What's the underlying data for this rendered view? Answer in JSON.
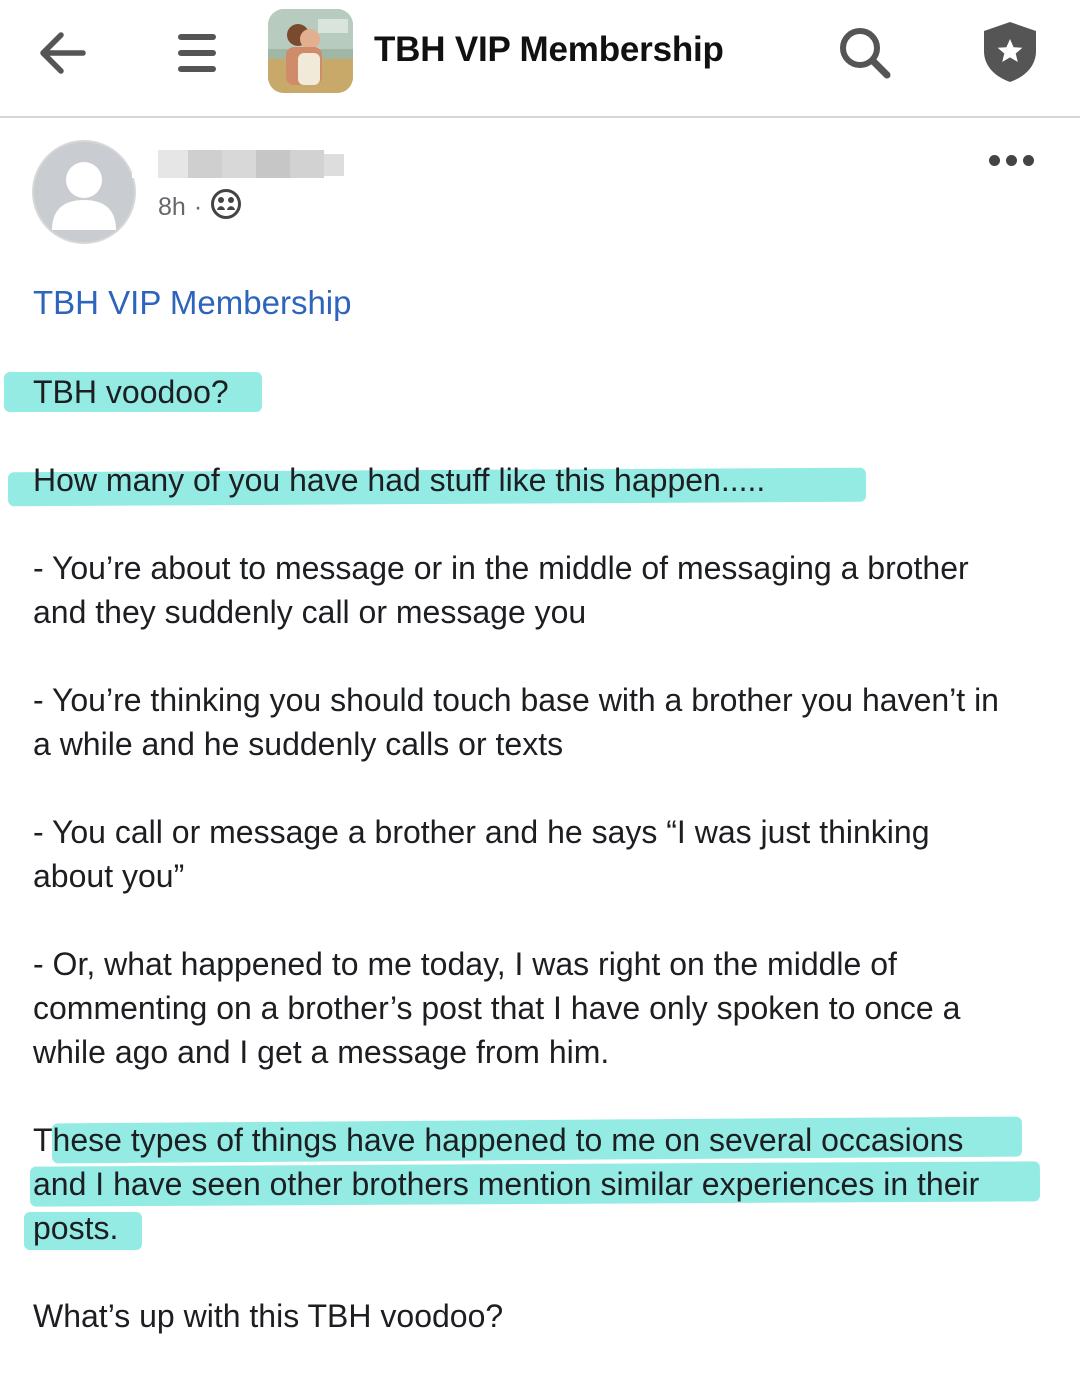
{
  "topbar": {
    "title": "TBH VIP Membership",
    "icons": [
      "back-arrow-icon",
      "menu-icon",
      "group-thumbnail",
      "search-icon",
      "shield-star-icon"
    ]
  },
  "post": {
    "time": "8h",
    "separator": "·",
    "audience_icon": "members-icon",
    "group_name": "TBH VIP Membership",
    "lines": {
      "title": "TBH voodoo?",
      "intro": "How many of you have had stuff like this happen.....",
      "item1_l1": "- You’re about to message or in the middle of messaging a brother",
      "item1_l2": "and they suddenly call or message you",
      "item2_l1": "- You’re thinking you should touch base with a brother you haven’t in",
      "item2_l2": "a while and he suddenly calls or texts",
      "item3_l1": "- You call or message a brother and he says “I was just thinking",
      "item3_l2": "about you”",
      "item4_l1": "- Or, what happened to me today, I was right on the middle of",
      "item4_l2": "commenting on a brother’s post that I have only spoken to once a",
      "item4_l3": "while ago and I get a message from him.",
      "para_l1": "These types of things have happened to me on several occasions",
      "para_l2": "and I have seen other brothers mention similar experiences in their",
      "para_l3": "posts.",
      "closing": "What’s up with this TBH voodoo?"
    }
  },
  "colors": {
    "link": "#2d64bc",
    "highlight": "#80e8df",
    "text": "#1c1e21",
    "meta": "#65676b"
  }
}
